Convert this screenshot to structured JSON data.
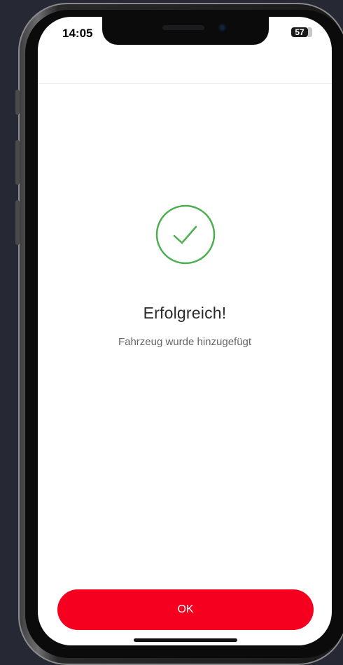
{
  "status_bar": {
    "time": "14:05",
    "battery_level": "57"
  },
  "content": {
    "icon": "checkmark-circle-icon",
    "title": "Erfolgreich!",
    "subtitle": "Fahrzeug wurde hinzugefügt"
  },
  "footer": {
    "ok_label": "OK"
  },
  "colors": {
    "accent": "#f5001e",
    "success": "#4caf50",
    "background": "#ffffff",
    "device_backdrop": "#262833"
  }
}
